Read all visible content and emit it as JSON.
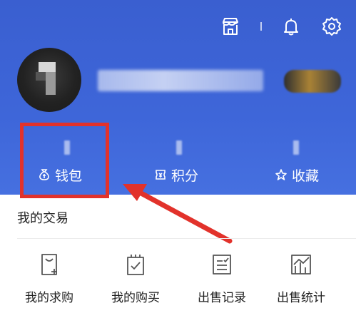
{
  "header": {
    "icons": [
      "store-icon",
      "bell-icon",
      "gear-icon"
    ]
  },
  "stats": [
    {
      "label": "钱包",
      "icon": "wallet-icon"
    },
    {
      "label": "积分",
      "icon": "points-icon"
    },
    {
      "label": "收藏",
      "icon": "star-icon"
    }
  ],
  "section": {
    "title": "我的交易"
  },
  "actions": [
    {
      "label": "我的求购",
      "icon": "request-bag-icon"
    },
    {
      "label": "我的购买",
      "icon": "purchase-bag-icon"
    },
    {
      "label": "出售记录",
      "icon": "sales-record-icon"
    },
    {
      "label": "出售统计",
      "icon": "sales-chart-icon"
    }
  ],
  "colors": {
    "header_blue": "#3e66d9",
    "highlight_red": "#e2322b"
  }
}
